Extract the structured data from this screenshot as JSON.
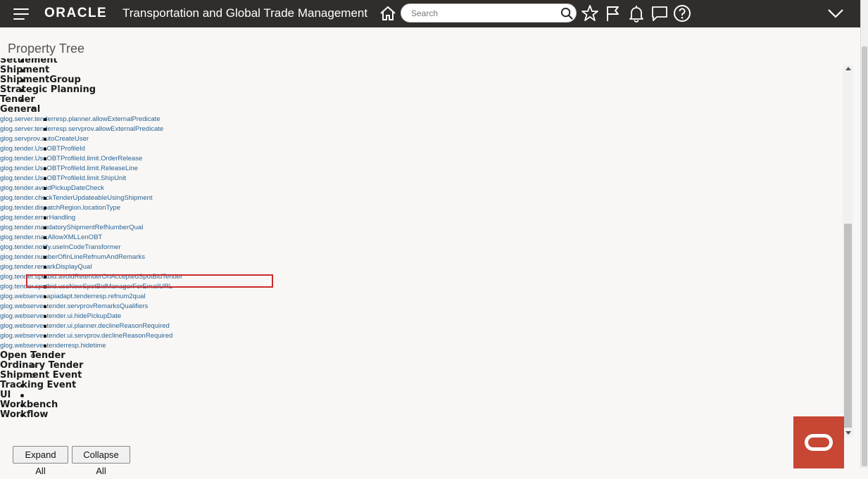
{
  "header": {
    "logo": "ORACLE",
    "app_title": "Transportation and Global Trade Management",
    "search_placeholder": "Search",
    "colors": {
      "bar": "#312d2a",
      "brand": "#c74634"
    },
    "icons": [
      "menu-icon",
      "home-icon",
      "search-icon",
      "favorites-star-icon",
      "flag-icon",
      "notifications-bell-icon",
      "messages-icon",
      "help-icon",
      "chevron-down-icon"
    ]
  },
  "page": {
    "title": "Property Tree"
  },
  "tree": {
    "top_before": [
      "Settlement",
      "Shipment",
      "ShipmentGroup",
      "Strategic Planning",
      "Tender"
    ],
    "tender_children": [
      "General",
      "Open Tender",
      "Ordinary Tender",
      "Shipment Event"
    ],
    "general_properties": [
      "glog.server.tenderresp.planner.allowExternalPredicate",
      "glog.server.tenderresp.servprov.allowExternalPredicate",
      "glog.servprov.autoCreateUser",
      "glog.tender.UseOBTProfileId",
      "glog.tender.UseOBTProfileId.limit.OrderRelease",
      "glog.tender.UseOBTProfileId.limit.ReleaseLine",
      "glog.tender.UseOBTProfileId.limit.ShipUnit",
      "glog.tender.avoidPickupDateCheck",
      "glog.tender.checkTenderUpdateableUsingShipment",
      "glog.tender.dispatchRegion.locationType",
      "glog.tender.errorHandling",
      "glog.tender.mandatoryShipmentRefNumberQual",
      "glog.tender.maxAllowXMLLenOBT",
      "glog.tender.notify.useInCodeTransformer",
      "glog.tender.numberOfInLineRefnumAndRemarks",
      "glog.tender.remarkDisplayQual",
      "glog.tender.spotbid.avoidRetenderOnAcceptedSpotBidTender",
      "glog.tender.spotbid.useNewSpotBidManagerForEmailURL",
      "glog.webserver.apiadapt.tenderresp.refnum2qual",
      "glog.webserver.tender.servprovRemarksQualifiers",
      "glog.webserver.tender.ui.hidePickupDate",
      "glog.webserver.tender.ui.planner.declineReasonRequired",
      "glog.webserver.tender.ui.servprov.declineReasonRequired",
      "glog.webserver.tenderresp.hidetime"
    ],
    "top_after": [
      "Tracking Event",
      "UI",
      "Workbench",
      "Workflow"
    ],
    "highlighted_property": "glog.tender.spotbid.avoidRetenderOnAcceptedSpotBidTender"
  },
  "buttons": {
    "expand_all": "Expand All",
    "collapse_all": "Collapse All"
  }
}
